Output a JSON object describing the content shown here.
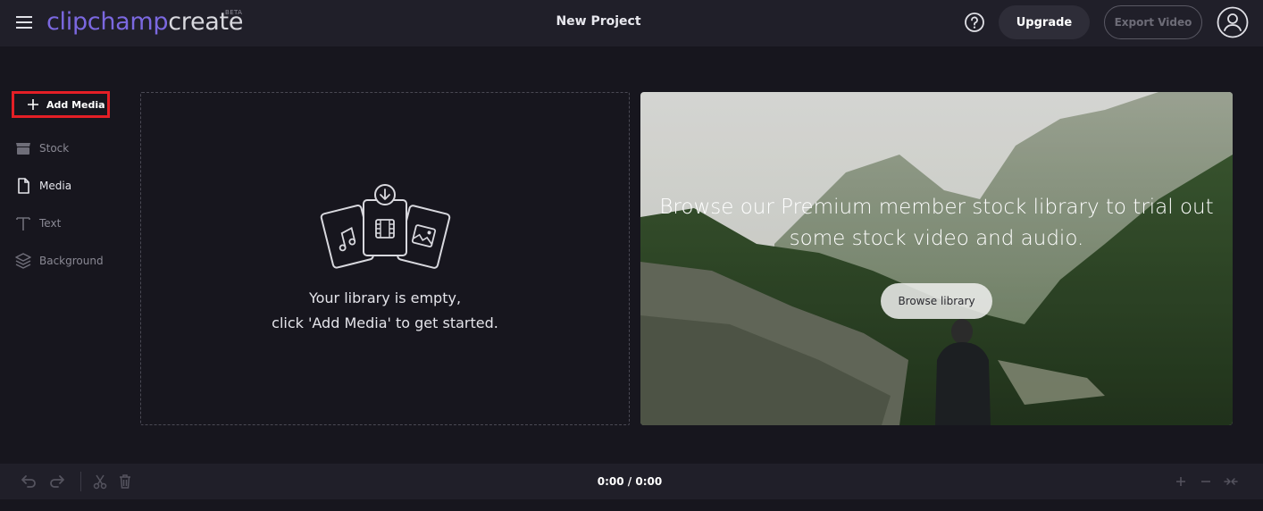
{
  "header": {
    "logo_part1": "clipchamp",
    "logo_part2": "create",
    "beta_badge": "BETA",
    "project_title": "New Project",
    "upgrade_label": "Upgrade",
    "export_label": "Export Video",
    "icons": [
      "menu-icon",
      "help-icon",
      "user-avatar-icon"
    ]
  },
  "sidebar": {
    "add_media_label": "Add Media",
    "items": [
      {
        "label": "Stock",
        "icon": "stock-icon"
      },
      {
        "label": "Media",
        "icon": "file-icon",
        "active": true
      },
      {
        "label": "Text",
        "icon": "text-icon"
      },
      {
        "label": "Background",
        "icon": "layers-icon"
      }
    ]
  },
  "library": {
    "empty_line1": "Your library is empty,",
    "empty_line2": "click 'Add Media' to get started."
  },
  "promo": {
    "message_line1": "Browse our Premium member stock library to trial out",
    "message_line2": "some stock video and audio.",
    "button_label": "Browse library"
  },
  "timeline": {
    "timecode": "0:00 / 0:00"
  },
  "colors": {
    "accent": "#7b68e0",
    "background": "#17161e",
    "header": "#201f29",
    "highlight_box": "#e41f26"
  }
}
